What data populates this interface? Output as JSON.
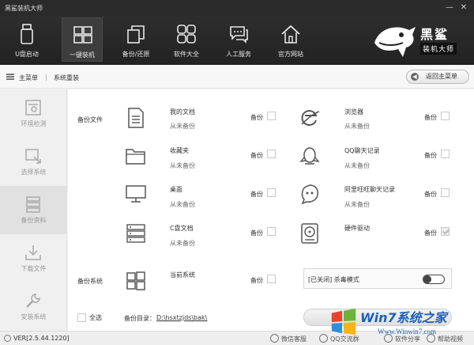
{
  "window": {
    "title": "黑鲨装机大师",
    "min_label": "—",
    "close_label": "✕"
  },
  "toolbar": {
    "items": [
      {
        "label": "U盘启动",
        "icon": "usb-drive-icon"
      },
      {
        "label": "一键装机",
        "icon": "windows-icon"
      },
      {
        "label": "备份/还原",
        "icon": "backup-restore-icon"
      },
      {
        "label": "软件大全",
        "icon": "apps-grid-icon"
      },
      {
        "label": "人工服务",
        "icon": "chat-service-icon"
      },
      {
        "label": "官方网站",
        "icon": "home-icon"
      }
    ],
    "active_index": 1
  },
  "logo": {
    "line1": "黑鲨",
    "line2": "装机大师",
    "icon": "shark-logo-icon"
  },
  "breadcrumb": {
    "home": "主菜单",
    "separator": "|",
    "current": "系统重装"
  },
  "back_button": {
    "label": "返回主菜单",
    "icon": "back-arrow-icon"
  },
  "sidebar": {
    "items": [
      {
        "label": "环境检测",
        "icon": "environment-check-icon"
      },
      {
        "label": "选择系统",
        "icon": "select-system-icon"
      },
      {
        "label": "备份资料",
        "icon": "backup-data-icon"
      },
      {
        "label": "下载文件",
        "icon": "download-icon"
      },
      {
        "label": "安装系统",
        "icon": "install-wrench-icon"
      }
    ],
    "active_index": 2
  },
  "backup_files": {
    "section_label": "备份文件",
    "items": [
      {
        "title": "我的文档",
        "sub": "从未备份",
        "backup": "备份",
        "checked": false,
        "icon": "document-icon"
      },
      {
        "title": "浏览器",
        "sub": "从未备份",
        "backup": "备份",
        "checked": false,
        "icon": "browser-icon"
      },
      {
        "title": "收藏夹",
        "sub": "从未备份",
        "backup": "备份",
        "checked": false,
        "icon": "folder-icon"
      },
      {
        "title": "QQ聊天记录",
        "sub": "从未备份",
        "backup": "备份",
        "checked": false,
        "icon": "qq-icon"
      },
      {
        "title": "桌面",
        "sub": "从未备份",
        "backup": "备份",
        "checked": false,
        "icon": "monitor-icon"
      },
      {
        "title": "阿里旺旺聊天记录",
        "sub": "从未备份",
        "backup": "备份",
        "checked": false,
        "icon": "wangwang-icon"
      },
      {
        "title": "C盘文档",
        "sub": "从未备份",
        "backup": "备份",
        "checked": false,
        "icon": "server-disk-icon"
      },
      {
        "title": "硬件驱动",
        "sub": "",
        "backup": "备份",
        "checked": true,
        "icon": "hard-drive-icon"
      }
    ]
  },
  "backup_system": {
    "section_label": "备份系统",
    "title": "当前系统",
    "backup": "备份",
    "checked": false,
    "icon": "windows-icon"
  },
  "antivirus": {
    "label": "[已关闭] 杀毒模式",
    "enabled": false
  },
  "footer": {
    "select_all": "全选",
    "dir_label": "备份目录：",
    "dir_path": "D:\\hsxtzjds\\bak\\"
  },
  "statusbar": {
    "version": "VER[2.5.44.1220]",
    "links": [
      {
        "label": "微信客服",
        "icon": "wechat-icon"
      },
      {
        "label": "QQ交流群",
        "icon": "qq-group-icon"
      },
      {
        "label": "软件分享",
        "icon": "share-icon"
      },
      {
        "label": "帮助视频",
        "icon": "help-video-icon"
      }
    ]
  },
  "watermark": {
    "line1": "Win7系统之家",
    "line2": "Www.Winwin7.com"
  }
}
